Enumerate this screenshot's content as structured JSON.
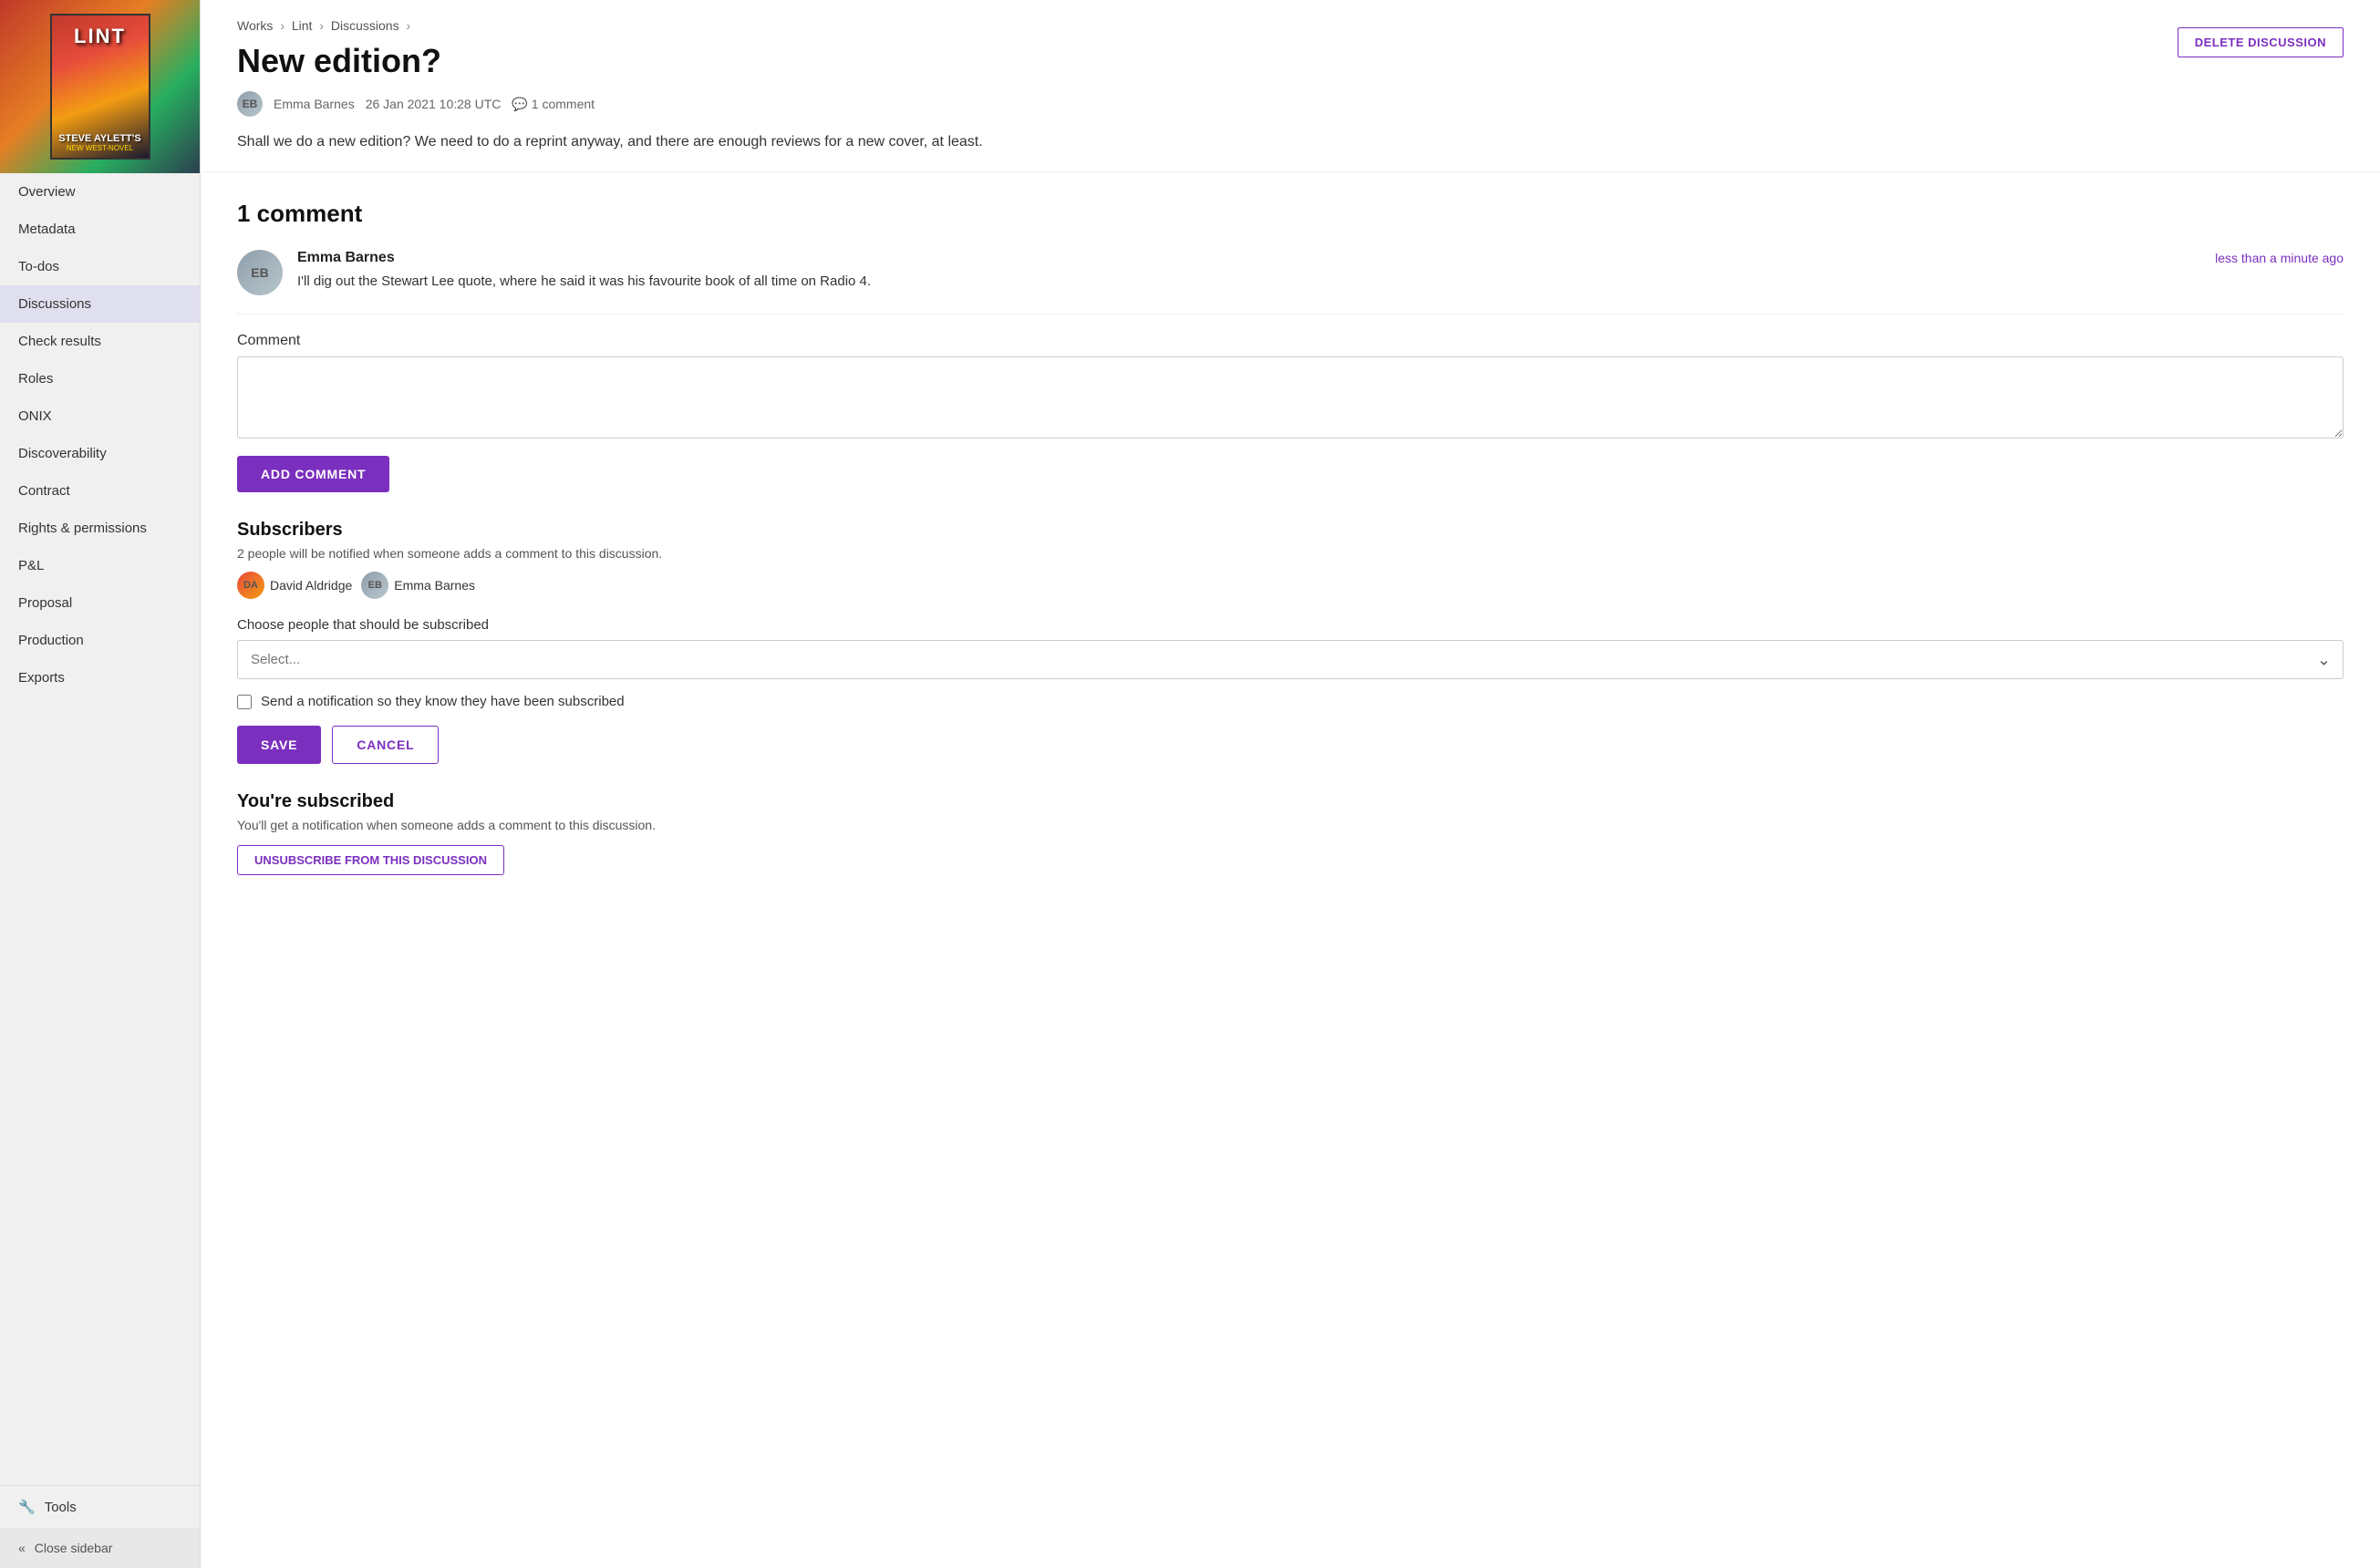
{
  "sidebar": {
    "nav_items": [
      {
        "label": "Overview",
        "id": "overview",
        "active": false
      },
      {
        "label": "Metadata",
        "id": "metadata",
        "active": false
      },
      {
        "label": "To-dos",
        "id": "todos",
        "active": false
      },
      {
        "label": "Discussions",
        "id": "discussions",
        "active": true
      },
      {
        "label": "Check results",
        "id": "check-results",
        "active": false
      },
      {
        "label": "Roles",
        "id": "roles",
        "active": false
      },
      {
        "label": "ONIX",
        "id": "onix",
        "active": false
      },
      {
        "label": "Discoverability",
        "id": "discoverability",
        "active": false
      },
      {
        "label": "Contract",
        "id": "contract",
        "active": false
      },
      {
        "label": "Rights & permissions",
        "id": "rights-permissions",
        "active": false
      },
      {
        "label": "P&L",
        "id": "pl",
        "active": false
      },
      {
        "label": "Proposal",
        "id": "proposal",
        "active": false
      },
      {
        "label": "Production",
        "id": "production",
        "active": false
      },
      {
        "label": "Exports",
        "id": "exports",
        "active": false
      }
    ],
    "tools_label": "Tools",
    "close_sidebar_label": "Close sidebar"
  },
  "breadcrumb": {
    "works_label": "Works",
    "lint_label": "Lint",
    "discussions_label": "Discussions"
  },
  "discussion": {
    "title": "New edition?",
    "author": "Emma Barnes",
    "date": "26 Jan 2021 10:28 UTC",
    "comment_count_label": "1 comment",
    "body": "Shall we do a new edition? We need to do a reprint anyway, and there are enough reviews for a new cover, at least.",
    "delete_button_label": "DELETE DISCUSSION"
  },
  "comments_section": {
    "heading": "1 comment",
    "comments": [
      {
        "author": "Emma Barnes",
        "time": "less than a minute ago",
        "text": "I'll dig out the Stewart Lee quote, where he said it was his favourite book of all time on Radio 4."
      }
    ]
  },
  "comment_form": {
    "label": "Comment",
    "placeholder": "",
    "add_button_label": "ADD COMMENT"
  },
  "subscribers": {
    "heading": "Subscribers",
    "description": "2 people will be notified when someone adds a comment to this discussion.",
    "subscribers_list": [
      {
        "name": "David Aldridge"
      },
      {
        "name": "Emma Barnes"
      }
    ],
    "choose_label": "Choose people that should be subscribed",
    "select_placeholder": "Select...",
    "notification_label": "Send a notification so they know they have been subscribed",
    "save_button_label": "SAVE",
    "cancel_button_label": "CANCEL"
  },
  "subscribed": {
    "heading": "You're subscribed",
    "description": "You'll get a notification when someone adds a comment to this discussion.",
    "unsubscribe_label": "UNSUBSCRIBE FROM THIS DISCUSSION"
  },
  "icons": {
    "chevron_left": "«",
    "chevron_down": "⌄",
    "chat_bubble": "💬",
    "wrench": "🔧"
  }
}
